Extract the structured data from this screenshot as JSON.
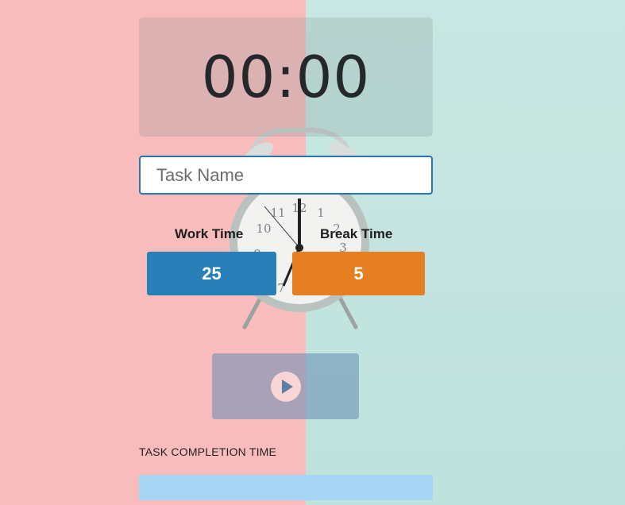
{
  "timer": {
    "display": "00:00"
  },
  "task": {
    "placeholder": "Task Name",
    "value": ""
  },
  "work": {
    "label": "Work Time",
    "value": "25"
  },
  "break": {
    "label": "Break Time",
    "value": "5"
  },
  "controls": {
    "play_icon": "play-icon"
  },
  "completion": {
    "label": "TASK COMPLETION TIME"
  },
  "colors": {
    "background_left": "#f9bcbc",
    "background_right": "#c8e7e2",
    "work_box": "#2980b9",
    "break_box": "#e67e22",
    "input_border": "#2a74b0",
    "completion_bar": "#a6d5f5"
  }
}
